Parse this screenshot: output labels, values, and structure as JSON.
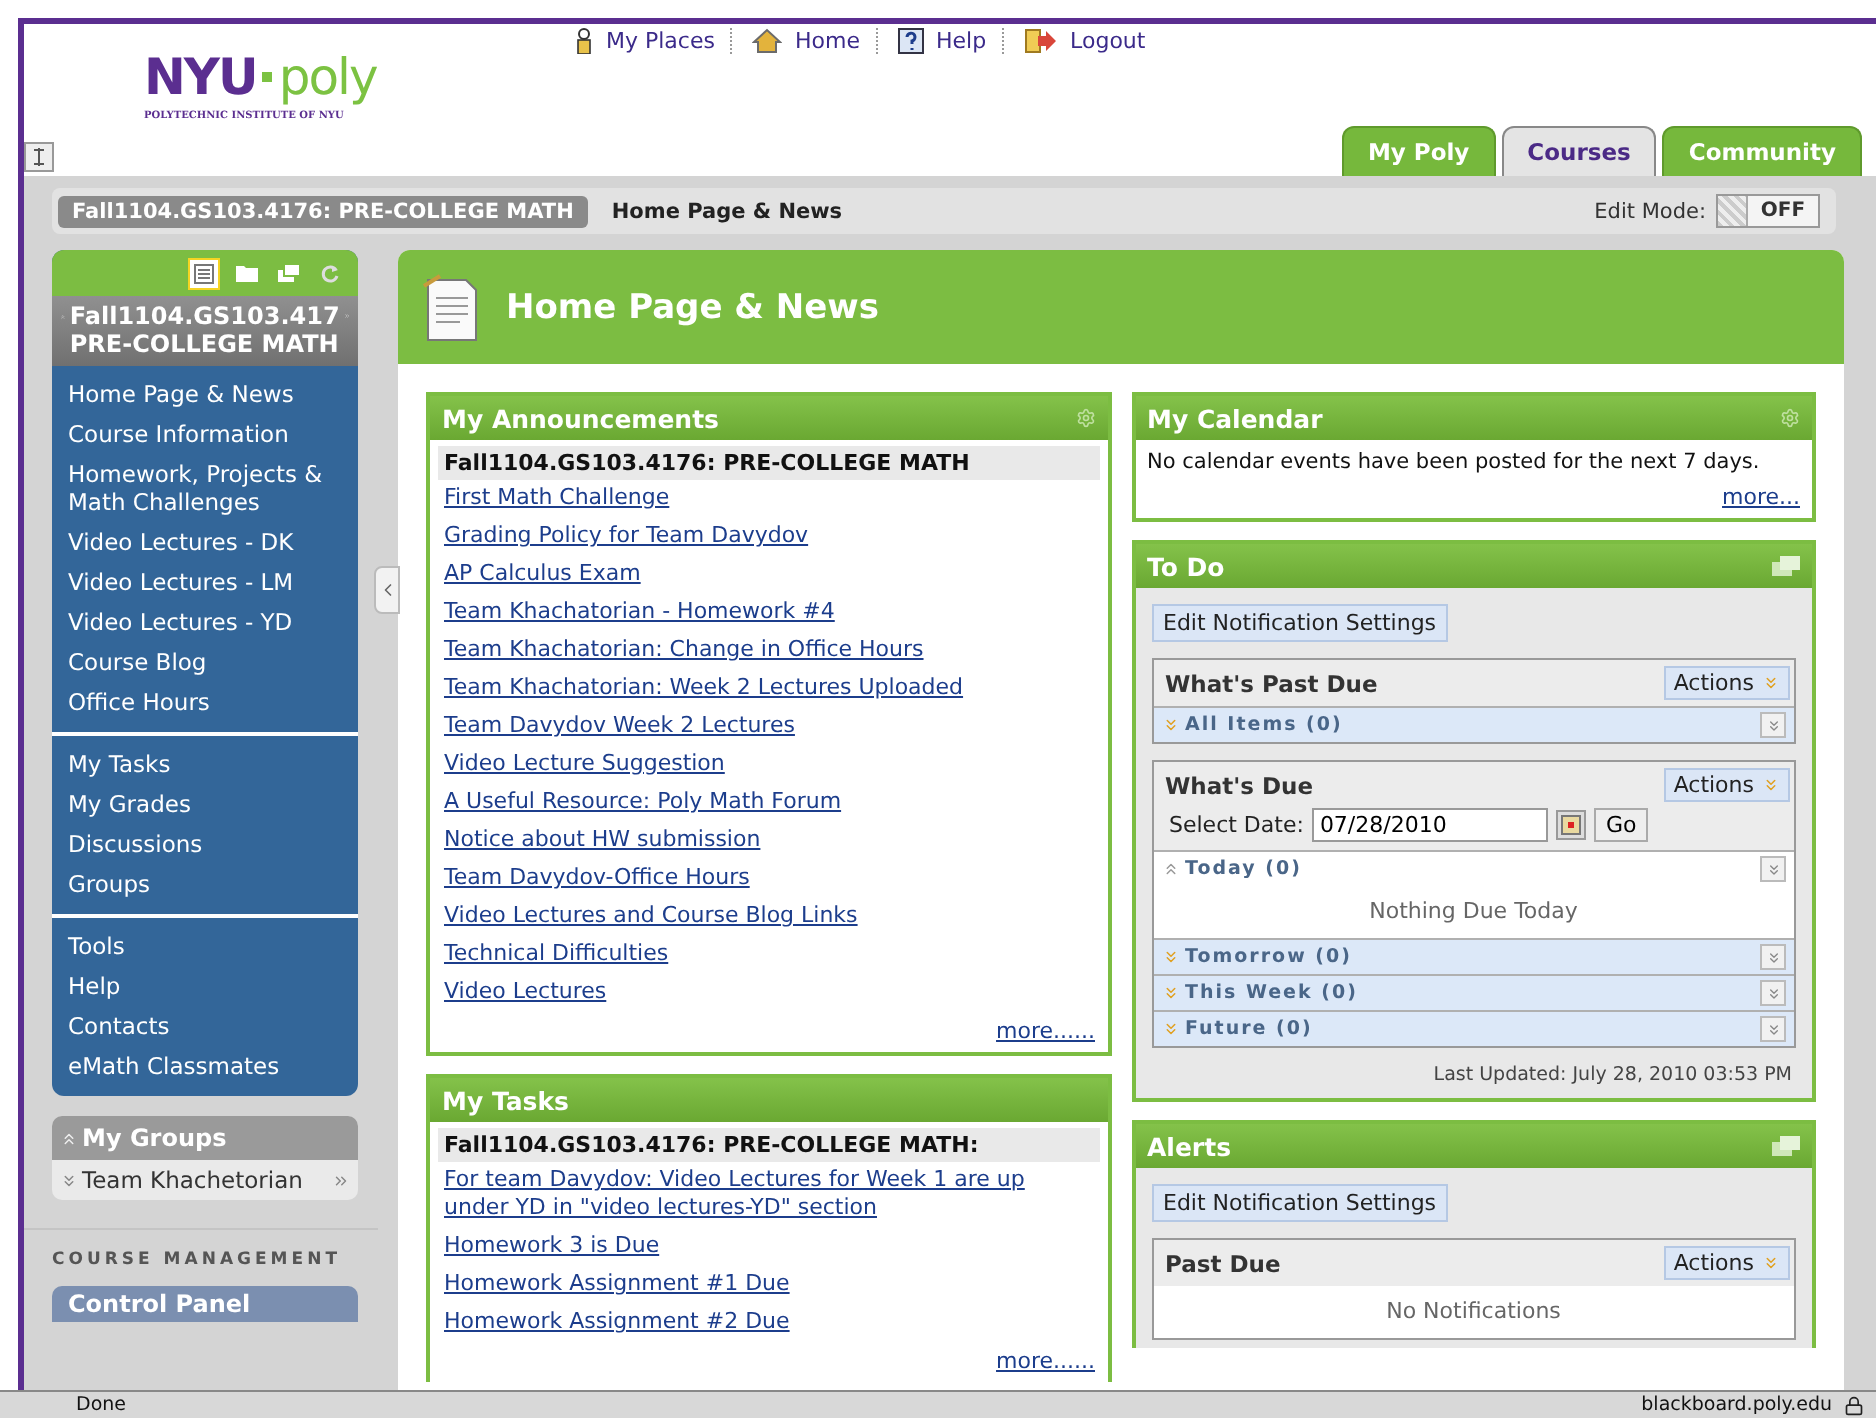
{
  "top_nav": [
    {
      "label": "My Places"
    },
    {
      "label": "Home"
    },
    {
      "label": "Help"
    },
    {
      "label": "Logout"
    }
  ],
  "logo": {
    "left": "NYU",
    "right": "poly",
    "tagline": "POLYTECHNIC INSTITUTE OF NYU"
  },
  "tabs": [
    {
      "label": "My Poly",
      "selected": false
    },
    {
      "label": "Courses",
      "selected": true
    },
    {
      "label": "Community",
      "selected": false
    }
  ],
  "breadcrumb": {
    "course": "Fall1104.GS103.4176: PRE-COLLEGE MATH",
    "page": "Home Page & News"
  },
  "edit_mode": {
    "label": "Edit Mode:",
    "value": "OFF",
    "on": false
  },
  "course_menu": {
    "views": [
      {
        "selected": true
      },
      {
        "selected": false
      },
      {
        "selected": false
      },
      {
        "selected": false
      }
    ],
    "title": "Fall1104.GS103.417",
    "subtitle": "PRE-COLLEGE MATH",
    "sections": [
      [
        "Home Page & News",
        "Course Information",
        "Homework, Projects & Math Challenges",
        "Video Lectures - DK",
        "Video Lectures - LM",
        "Video Lectures - YD",
        "Course Blog",
        "Office Hours"
      ],
      [
        "My Tasks",
        "My Grades",
        "Discussions",
        "Groups"
      ],
      [
        "Tools",
        "Help",
        "Contacts",
        "eMath Classmates"
      ]
    ]
  },
  "my_groups": {
    "title": "My Groups",
    "items": [
      "Team Khachetorian"
    ]
  },
  "course_management": {
    "label": "COURSE MANAGEMENT",
    "items": [
      "Control Panel"
    ]
  },
  "page_title": "Home Page & News",
  "announcements": {
    "title": "My Announcements",
    "course": "Fall1104.GS103.4176: PRE-COLLEGE MATH",
    "links": [
      "First Math Challenge",
      "Grading Policy for Team Davydov",
      "AP Calculus Exam",
      "Team Khachatorian - Homework #4",
      "Team Khachatorian: Change in Office Hours",
      "Team Khachatorian: Week 2 Lectures Uploaded",
      "Team Davydov Week 2 Lectures",
      "Video Lecture Suggestion",
      "A Useful Resource: Poly Math Forum",
      "Notice about HW submission",
      "Team Davydov-Office Hours",
      "Video Lectures and Course Blog Links",
      "Technical Difficulties",
      "Video Lectures"
    ],
    "more": "more......"
  },
  "tasks": {
    "title": "My Tasks",
    "course": "Fall1104.GS103.4176: PRE-COLLEGE MATH:",
    "links": [
      "For team Davydov: Video Lectures for Week 1 are up under YD in \"video lectures-YD\" section",
      "Homework 3 is Due",
      "Homework Assignment #1 Due",
      "Homework Assignment #2 Due"
    ],
    "more": "more......"
  },
  "calendar": {
    "title": "My Calendar",
    "message": "No calendar events have been posted for the next 7 days.",
    "more": "more..."
  },
  "todo": {
    "title": "To Do",
    "settings_button": "Edit Notification Settings",
    "groups": [
      {
        "title": "What's Past Due",
        "actions": "Actions",
        "sections": [
          {
            "label": "All Items (0)",
            "expanded": false
          }
        ]
      },
      {
        "title": "What's Due",
        "actions": "Actions",
        "date_label": "Select Date:",
        "date": "07/28/2010",
        "go": "Go",
        "sections": [
          {
            "label": "Today (0)",
            "expanded": true,
            "message": "Nothing Due Today"
          },
          {
            "label": "Tomorrow (0)",
            "expanded": false
          },
          {
            "label": "This Week (0)",
            "expanded": false
          },
          {
            "label": "Future (0)",
            "expanded": false
          }
        ]
      }
    ],
    "last_updated": "Last Updated: July 28, 2010 03:53 PM"
  },
  "alerts": {
    "title": "Alerts",
    "settings_button": "Edit Notification Settings",
    "groups": [
      {
        "title": "Past Due",
        "actions": "Actions",
        "message": "No Notifications"
      }
    ]
  },
  "status_bar": {
    "status": "Done",
    "host": "blackboard.poly.edu"
  }
}
